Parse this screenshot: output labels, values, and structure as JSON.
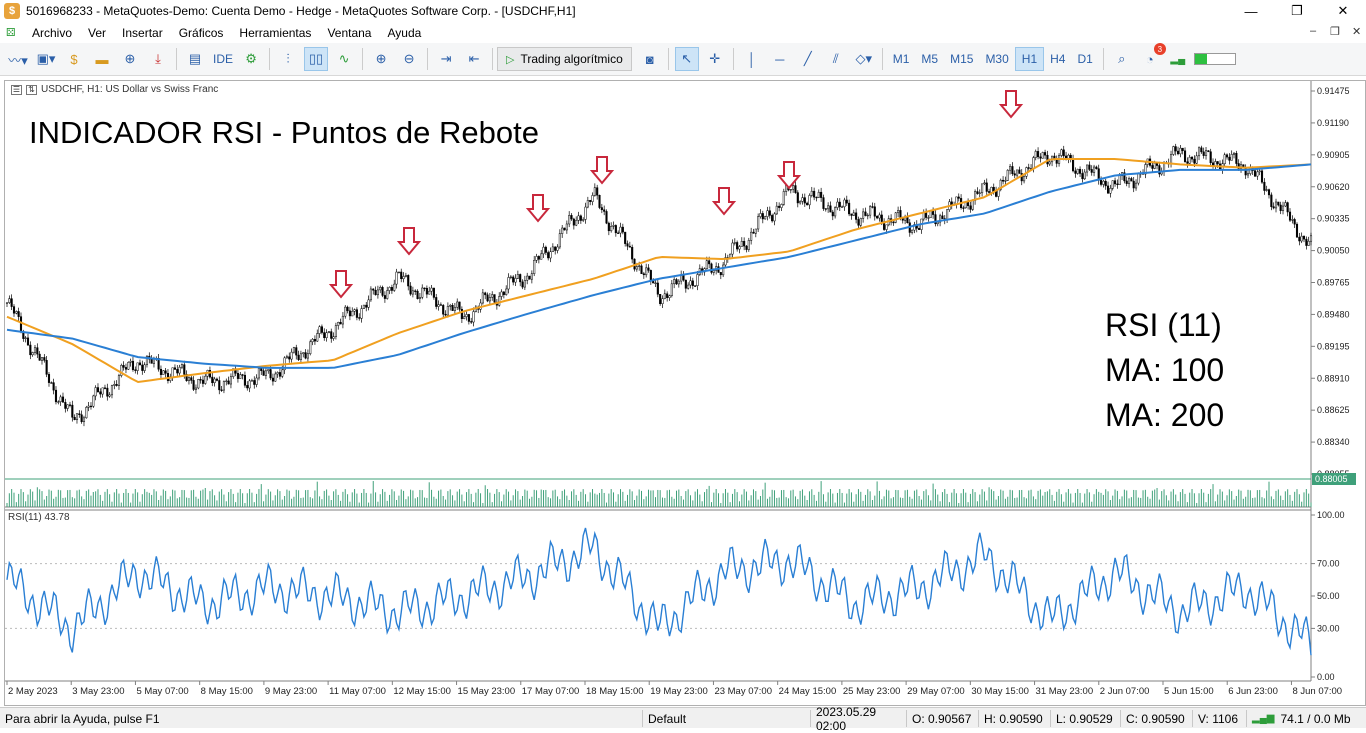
{
  "window": {
    "title": "5016968233 - MetaQuotes-Demo: Cuenta Demo - Hedge - MetaQuotes Software Corp. - [USDCHF,H1]",
    "controls": [
      "—",
      "❐",
      "✕"
    ]
  },
  "menu": {
    "items": [
      "Archivo",
      "Ver",
      "Insertar",
      "Gráficos",
      "Herramientas",
      "Ventana",
      "Ayuda"
    ]
  },
  "toolbar": {
    "ide_label": "IDE",
    "algo_trading_label": "Trading algorítmico",
    "timeframes": [
      "M1",
      "M5",
      "M15",
      "M30",
      "H1",
      "H4",
      "D1"
    ],
    "active_timeframe": "H1",
    "notifications_count": "3"
  },
  "chart": {
    "header": "USDCHF, H1:  US Dollar vs Swiss Franc",
    "overlay_title": "INDICADOR RSI - Puntos de Rebote",
    "params": [
      "RSI (11)",
      "MA: 100",
      "MA: 200"
    ],
    "rsi_label": "RSI(11) 43.78",
    "price_ticks": [
      "0.91475",
      "0.91190",
      "0.90905",
      "0.90620",
      "0.90335",
      "0.90050",
      "0.89765",
      "0.89480",
      "0.89195",
      "0.88910",
      "0.88625",
      "0.88340",
      "0.88055"
    ],
    "rsi_ticks": [
      "100.00",
      "70.00",
      "50.00",
      "30.00",
      "0.00"
    ],
    "time_labels": [
      "2 May 2023",
      "3 May 23:00",
      "5 May 07:00",
      "8 May 15:00",
      "9 May 23:00",
      "11 May 07:00",
      "12 May 15:00",
      "15 May 23:00",
      "17 May 07:00",
      "18 May 15:00",
      "19 May 23:00",
      "23 May 07:00",
      "24 May 15:00",
      "25 May 23:00",
      "29 May 07:00",
      "30 May 15:00",
      "31 May 23:00",
      "2 Jun 07:00",
      "5 Jun 15:00",
      "6 Jun 23:00",
      "8 Jun 07:00"
    ],
    "current_price_label": "0.88005",
    "colors": {
      "ma100": "#f0a020",
      "ma200": "#2a7fd4",
      "rsi": "#2a7fd4",
      "arrow": "#c8283c",
      "candle": "#000000",
      "volume": "#3fa07a"
    }
  },
  "chart_data": {
    "type": "line",
    "title": "USDCHF, H1:  US Dollar vs Swiss Franc",
    "series": [
      {
        "name": "USDCHF",
        "x": [
          "2 May 2023",
          "3 May 23:00",
          "5 May 07:00",
          "8 May 15:00",
          "9 May 23:00",
          "11 May 07:00",
          "12 May 15:00",
          "15 May 23:00",
          "17 May 07:00",
          "18 May 15:00",
          "19 May 23:00",
          "23 May 07:00",
          "24 May 15:00",
          "25 May 23:00",
          "29 May 07:00",
          "30 May 15:00",
          "31 May 23:00",
          "2 Jun 07:00",
          "5 Jun 15:00",
          "6 Jun 23:00",
          "8 Jun 07:00"
        ],
        "values": [
          0.8958,
          0.885,
          0.8905,
          0.8885,
          0.889,
          0.8935,
          0.898,
          0.8945,
          0.8985,
          0.9055,
          0.8965,
          0.8995,
          0.906,
          0.904,
          0.903,
          0.906,
          0.9095,
          0.9065,
          0.9095,
          0.9085,
          0.901
        ]
      },
      {
        "name": "MA: 100",
        "values": [
          0.8945,
          0.892,
          0.8885,
          0.8893,
          0.89,
          0.8905,
          0.893,
          0.895,
          0.8965,
          0.898,
          0.9,
          0.8998,
          0.9005,
          0.9025,
          0.904,
          0.9055,
          0.909,
          0.909,
          0.9085,
          0.9082,
          0.9085
        ]
      },
      {
        "name": "MA: 200",
        "values": [
          0.8933,
          0.8925,
          0.8908,
          0.8902,
          0.8898,
          0.8898,
          0.891,
          0.893,
          0.8948,
          0.8965,
          0.898,
          0.899,
          0.9,
          0.9015,
          0.903,
          0.904,
          0.906,
          0.9075,
          0.908,
          0.908,
          0.9085
        ]
      },
      {
        "name": "RSI(11)",
        "values": [
          60,
          30,
          65,
          45,
          55,
          50,
          40,
          50,
          62,
          80,
          30,
          65,
          72,
          45,
          55,
          75,
          35,
          65,
          40,
          55,
          20
        ]
      }
    ],
    "ylim": [
      0.88005,
      0.91525
    ],
    "rsi_ylim": [
      0,
      100
    ],
    "rsi_levels": [
      30,
      70
    ],
    "rebound_arrows_at": [
      "11 May 07:00",
      "12 May 15:00",
      "17 May 07:00",
      "18 May 15:00",
      "23 May 07:00",
      "24 May 15:00",
      "30 May 15:00"
    ]
  },
  "statusbar": {
    "help": "Para abrir la Ayuda, pulse F1",
    "profile": "Default",
    "datetime": "2023.05.29 02:00",
    "open": "O: 0.90567",
    "high": "H: 0.90590",
    "low": "L: 0.90529",
    "close": "C: 0.90590",
    "volume": "V: 1106",
    "traffic": "74.1 / 0.0 Mb"
  }
}
